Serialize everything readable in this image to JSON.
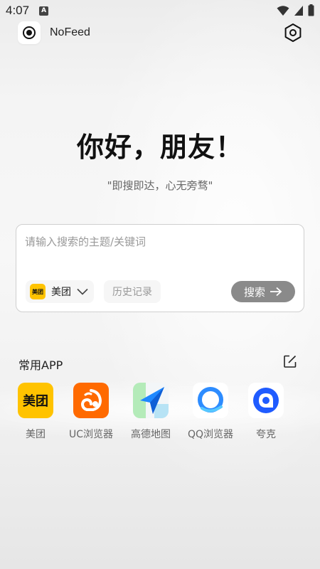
{
  "status_bar": {
    "time": "4:07",
    "notif_letter": "A"
  },
  "app": {
    "title": "NoFeed"
  },
  "greeting": "你好，朋友！",
  "slogan": "\"即搜即达，心无旁骛\"",
  "search": {
    "placeholder": "请输入搜索的主题/关键词",
    "value": "",
    "engine_label": "美团",
    "engine_icon_text": "美团",
    "history_label": "历史记录",
    "search_label": "搜索"
  },
  "apps_section": {
    "title": "常用APP",
    "apps": [
      {
        "label": "美团",
        "icon_text": "美团",
        "icon": "meituan-icon",
        "color": "#FFC300"
      },
      {
        "label": "UC浏览器",
        "icon": "uc-browser-icon",
        "color": "#FF6A00"
      },
      {
        "label": "高德地图",
        "icon": "amap-icon",
        "color": "#1E88FF"
      },
      {
        "label": "QQ浏览器",
        "icon": "qq-browser-icon",
        "color": "#2D8CFF"
      },
      {
        "label": "夸克",
        "icon": "quark-icon",
        "color": "#1F5BFF"
      }
    ]
  },
  "colors": {
    "search_button": "#8a8a8a",
    "card_border": "#cfcfcf",
    "meituan_yellow": "#FFC300"
  }
}
